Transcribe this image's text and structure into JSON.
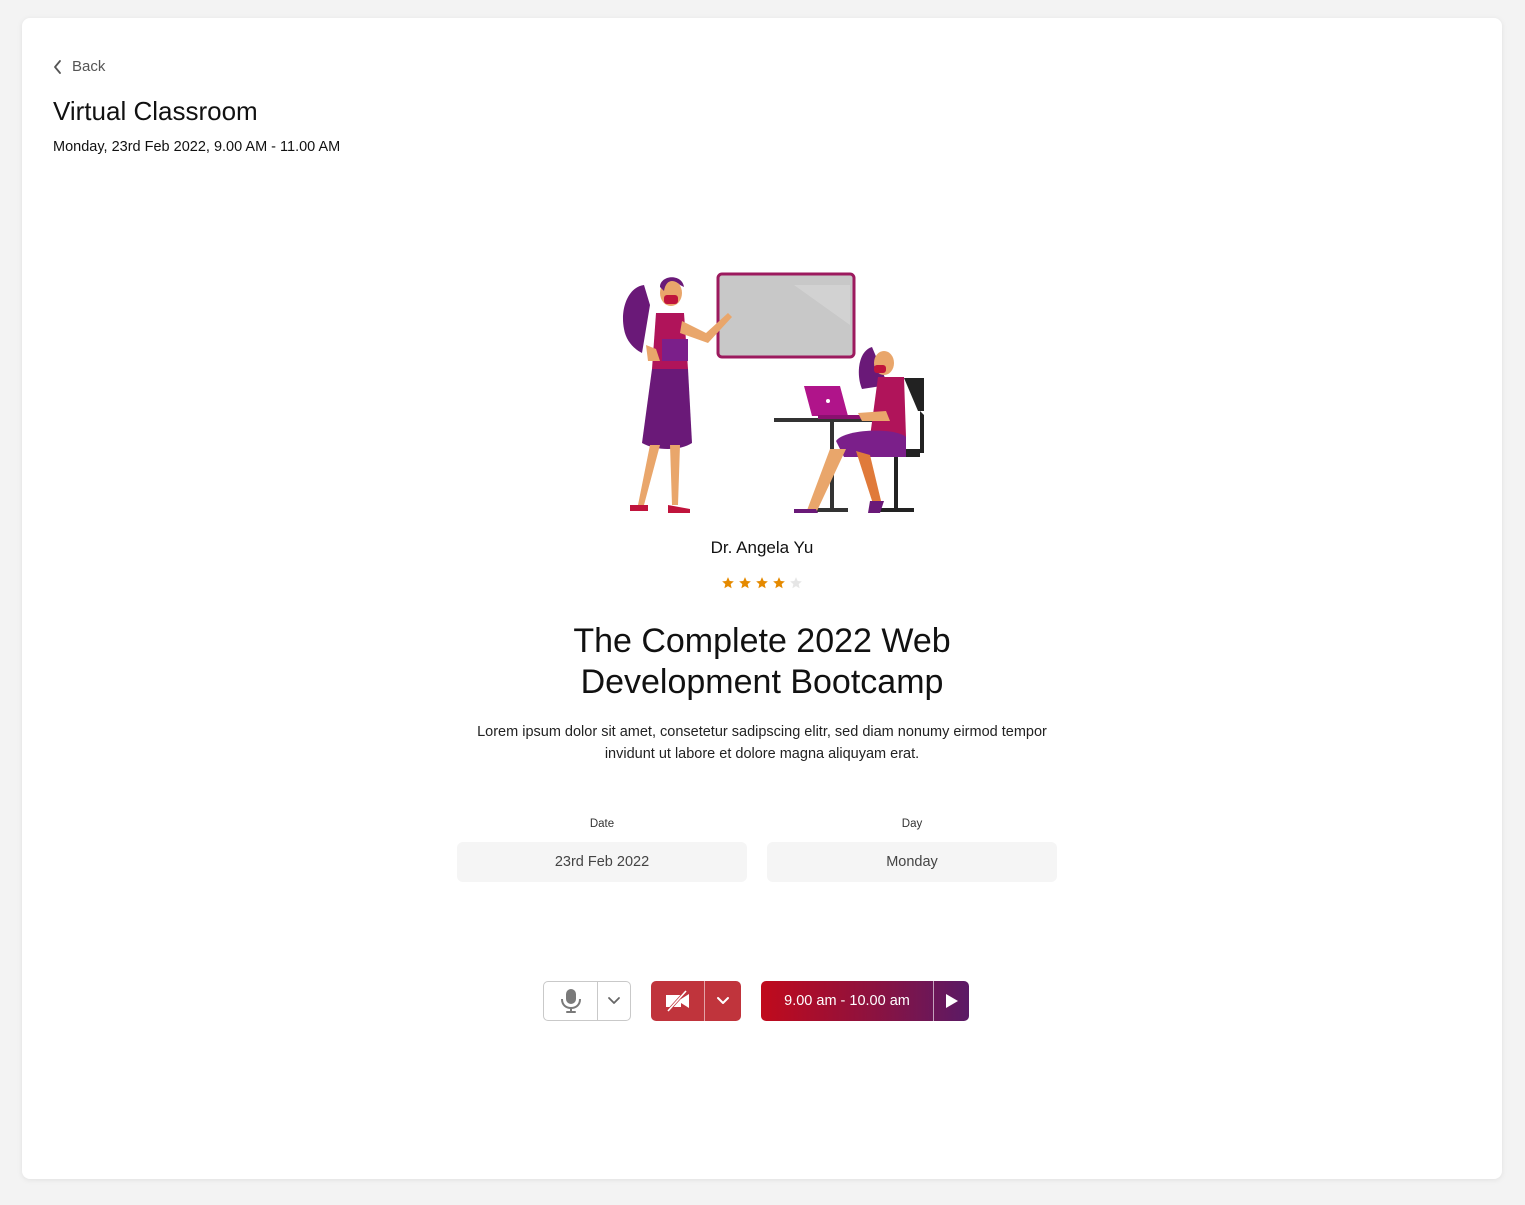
{
  "header": {
    "back_label": "Back",
    "title": "Virtual Classroom",
    "subtitle": "Monday, 23rd Feb 2022, 9.00 AM - 11.00 AM"
  },
  "instructor": {
    "name": "Dr. Angela Yu",
    "rating": 4,
    "rating_max": 5
  },
  "course": {
    "title_line1": "The Complete 2022 Web",
    "title_line2": "Development Bootcamp",
    "description": "Lorem ipsum dolor sit amet, consetetur sadipscing elitr, sed diam nonumy eirmod tempor invidunt ut labore et dolore magna aliquyam erat."
  },
  "fields": {
    "date": {
      "label": "Date",
      "value": "23rd Feb 2022"
    },
    "day": {
      "label": "Day",
      "value": "Monday"
    }
  },
  "controls": {
    "mic_icon": "microphone-icon",
    "camera_icon": "camera-off-icon",
    "session_label": "9.00 am - 10.00 am",
    "play_icon": "play-icon"
  },
  "colors": {
    "brand_red": "#c0343c",
    "gradient_start": "#c00a1c",
    "gradient_end": "#5a1a66",
    "star_filled": "#e58a00",
    "star_empty": "#e6e6e6"
  }
}
